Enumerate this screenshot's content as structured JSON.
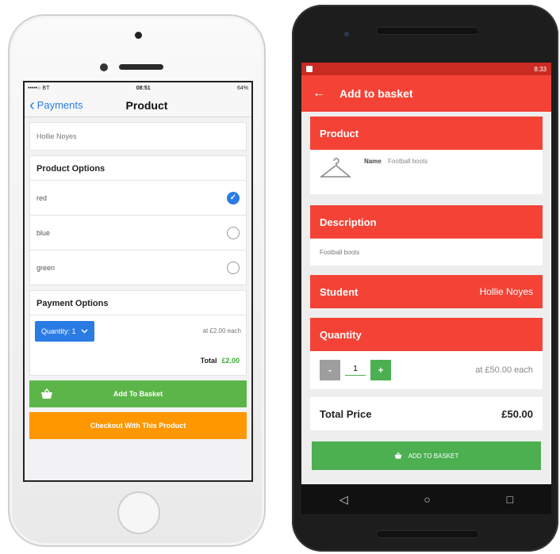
{
  "ios": {
    "status": {
      "carrier": "•••••○ BT",
      "time": "08:51",
      "battery": "64%"
    },
    "nav": {
      "back_label": "Payments",
      "title": "Product"
    },
    "student_name": "Hollie Noyes",
    "product_options": {
      "heading": "Product Options",
      "items": [
        {
          "label": "red",
          "selected": true
        },
        {
          "label": "blue",
          "selected": false
        },
        {
          "label": "green",
          "selected": false
        }
      ]
    },
    "payment_options": {
      "heading": "Payment Options",
      "quantity_label": "Quantity: 1",
      "each_text": "at £2.00 each",
      "total_label": "Total",
      "total_value": "£2.00"
    },
    "buttons": {
      "add_to_basket": "Add To Basket",
      "checkout": "Checkout With This Product"
    }
  },
  "android": {
    "status": {
      "time": "8:33"
    },
    "appbar_title": "Add to basket",
    "product": {
      "heading": "Product",
      "name_label": "Name",
      "name_value": "Football boots"
    },
    "description": {
      "heading": "Description",
      "text": "Football boots"
    },
    "student": {
      "label": "Student",
      "value": "Hollie Noyes"
    },
    "quantity": {
      "heading": "Quantity",
      "minus": "-",
      "value": "1",
      "plus": "+",
      "each_text": "at £50.00 each"
    },
    "total": {
      "label": "Total Price",
      "value": "£50.00"
    },
    "add_button": "ADD TO BASKET",
    "navbar": {
      "back": "◁",
      "home": "○",
      "recents": "□"
    }
  },
  "colors": {
    "ios_blue": "#2a7be4",
    "ios_green": "#5cb548",
    "ios_orange": "#ff9800",
    "android_red": "#f44336",
    "android_green": "#4caf50"
  }
}
